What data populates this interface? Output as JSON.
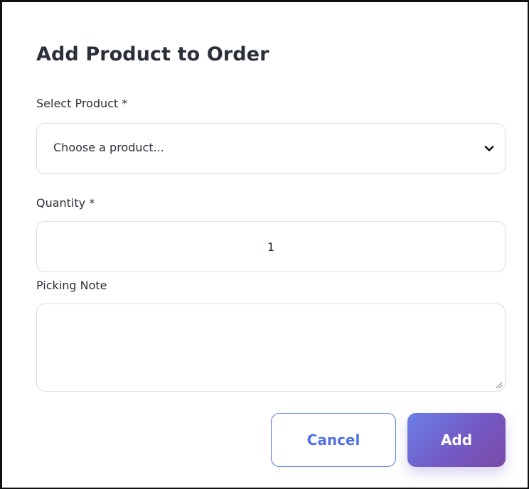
{
  "dialog": {
    "title": "Add Product to Order"
  },
  "product_field": {
    "label": "Select Product *",
    "selected_value": "Choose a product...",
    "icon": "chevron-down-icon"
  },
  "quantity_field": {
    "label": "Quantity *",
    "value": "1"
  },
  "note_field": {
    "label": "Picking Note",
    "value": ""
  },
  "actions": {
    "cancel_label": "Cancel",
    "add_label": "Add"
  },
  "colors": {
    "cancel_border": "#5b78e8",
    "add_gradient_start": "#6a7fe6",
    "add_gradient_end": "#7a4aa6"
  }
}
